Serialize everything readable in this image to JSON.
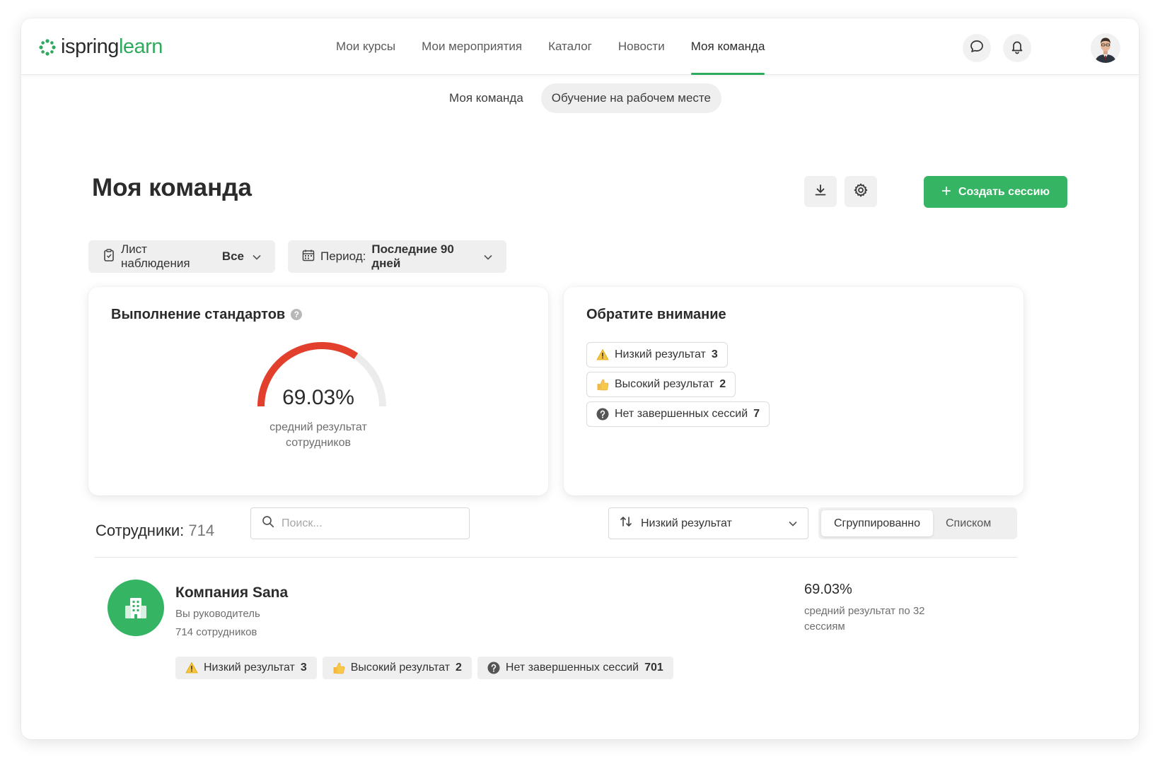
{
  "header": {
    "logo_part1": "ispring",
    "logo_part2": "learn",
    "nav": [
      "Мои курсы",
      "Мои мероприятия",
      "Каталог",
      "Новости",
      "Моя команда"
    ],
    "active_nav": "Моя команда"
  },
  "subtabs": [
    "Моя команда",
    "Обучение на рабочем месте"
  ],
  "page": {
    "title": "Моя команда",
    "create_button": "Создать сессию"
  },
  "filters": {
    "observation_label": "Лист наблюдения",
    "observation_value": "Все",
    "period_label": "Период:",
    "period_value": "Последние 90 дней"
  },
  "standards_card": {
    "title": "Выполнение стандартов",
    "help": "?",
    "value": "69.03%",
    "progress": 0.6903,
    "subtitle_line1": "средний результат",
    "subtitle_line2": "сотрудников"
  },
  "attention_card": {
    "title": "Обратите внимание",
    "items": [
      {
        "label": "Низкий результат",
        "count": "3",
        "icon": "warning-icon"
      },
      {
        "label": "Высокий результат",
        "count": "2",
        "icon": "thumbs-up-icon"
      },
      {
        "label": "Нет завершенных сессий",
        "count": "7",
        "icon": "question-icon"
      }
    ]
  },
  "employees": {
    "label": "Сотрудники:",
    "count": "714",
    "search_placeholder": "Поиск...",
    "sort_value": "Низкий результат",
    "view_grouped": "Сгруппированно",
    "view_list": "Списком"
  },
  "company": {
    "name": "Компания Sana",
    "role": "Вы руководитель",
    "employees": "714 сотрудников",
    "score": "69.03%",
    "score_sub": "средний результат по 32 сессиям",
    "tags": [
      {
        "label": "Низкий результат",
        "count": "3",
        "icon": "warning-icon"
      },
      {
        "label": "Высокий результат",
        "count": "2",
        "icon": "thumbs-up-icon"
      },
      {
        "label": "Нет завершенных сессий",
        "count": "701",
        "icon": "question-icon"
      }
    ]
  },
  "colors": {
    "accent": "#35b463",
    "gauge_fill": "#e2402d",
    "gauge_track": "#ececec"
  }
}
